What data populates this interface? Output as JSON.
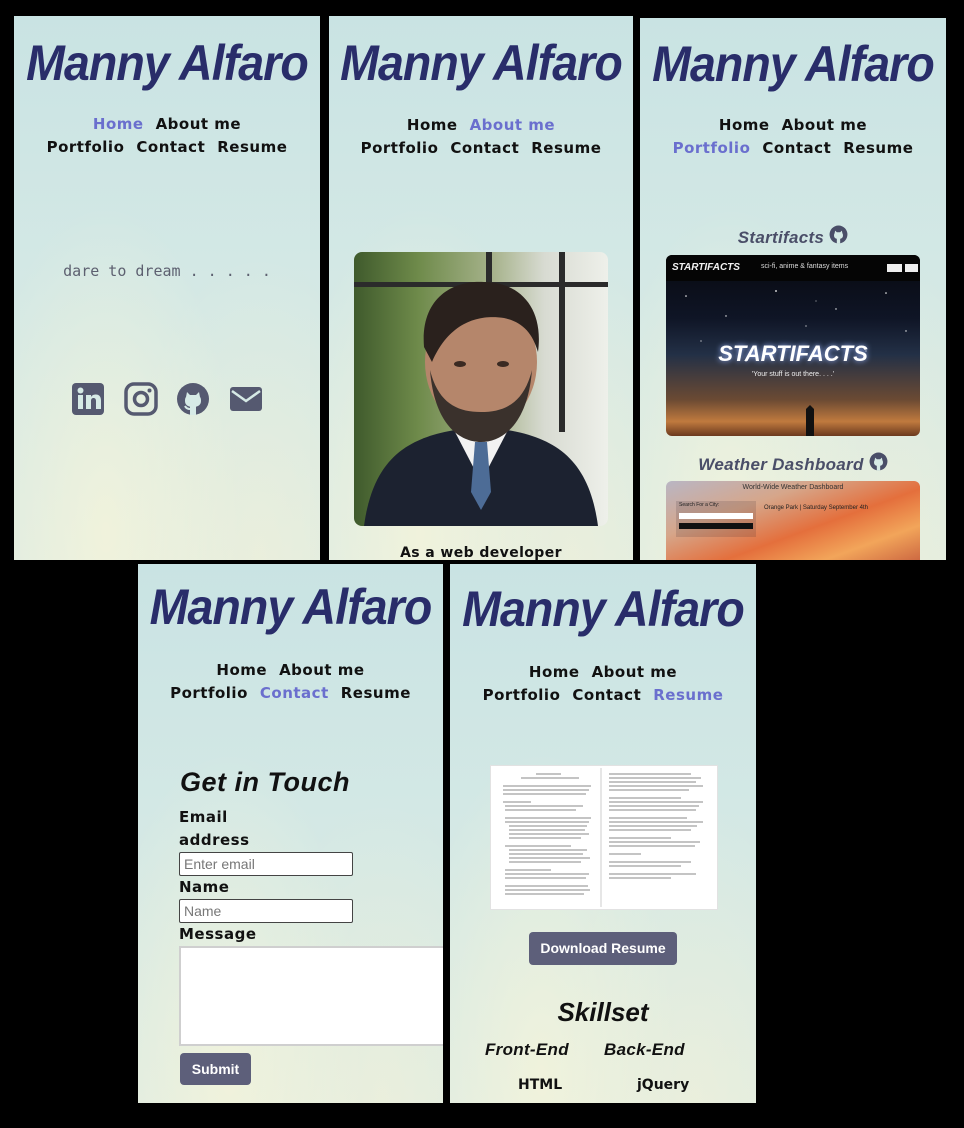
{
  "site": {
    "brand": "Manny Alfaro"
  },
  "nav": {
    "home": "Home",
    "about": "About me",
    "portfolio": "Portfolio",
    "contact": "Contact",
    "resume": "Resume",
    "active_color": "#6a6fce"
  },
  "home": {
    "tagline": "dare to dream . . . . .",
    "social_icons": [
      "linkedin-icon",
      "instagram-icon",
      "github-icon",
      "envelope-icon"
    ]
  },
  "about": {
    "intro_text": "As a web developer"
  },
  "portfolio": {
    "projects": [
      {
        "title": "Startifacts",
        "header_brand": "STARTIFACTS",
        "header_tagline": "sci-fi, anime & fantasy items",
        "hero_text": "STARTIFACTS",
        "hero_sub": "'Your stuff is out there. . . .'"
      },
      {
        "title": "Weather Dashboard",
        "header_text": "World-Wide Weather Dashboard",
        "search_label": "Search For a City:",
        "city_line": "Orange Park | Saturday September 4th"
      }
    ]
  },
  "contact": {
    "heading": "Get in Touch",
    "email_label_1": "Email",
    "email_label_2": "address",
    "email_placeholder": "Enter email",
    "name_label": "Name",
    "name_placeholder": "Name",
    "message_label": "Message",
    "submit_label": "Submit"
  },
  "resume": {
    "download_label": "Download Resume",
    "skillset_heading": "Skillset",
    "front_end_heading": "Front-End",
    "back_end_heading": "Back-End",
    "front_end_first": "HTML",
    "back_end_first": "jQuery"
  },
  "colors": {
    "brand": "#292d6a",
    "button": "#5d5f7a",
    "background": "#cfe6e4"
  }
}
